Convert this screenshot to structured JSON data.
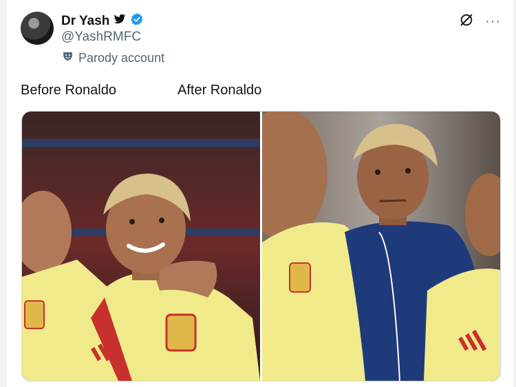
{
  "tweet": {
    "author": {
      "display_name": "Dr Yash",
      "handle": "@YashRMFC",
      "parody_label": "Parody account",
      "icons": [
        "twitter-bird-icon",
        "verified-badge-icon",
        "parody-mask-icon"
      ]
    },
    "actions": {
      "icons": [
        "grok-icon",
        "more-options-icon"
      ],
      "more_label": "···"
    },
    "text": {
      "left_caption": "Before Ronaldo",
      "right_caption": "After Ronaldo"
    },
    "media": {
      "left_panel": {
        "description_colors": {
          "kit": "#f1ea8a",
          "crowd": "#7a2a2a"
        }
      },
      "right_panel": {
        "description_colors": {
          "kit": "#f1ea8a",
          "jacket": "#1f3a7a"
        }
      }
    }
  },
  "colors": {
    "verified": "#1d9bf0",
    "muted": "#536471"
  }
}
